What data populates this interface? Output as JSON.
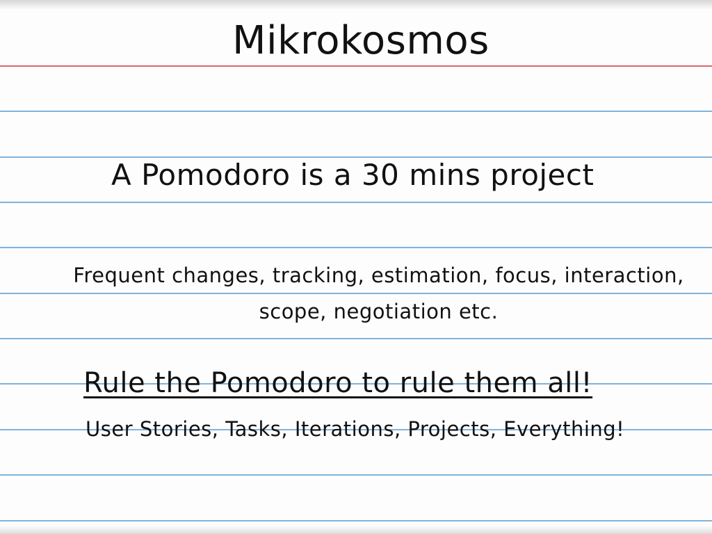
{
  "slide": {
    "title": "Mikrokosmos",
    "heading": "A Pomodoro is a 30 mins project",
    "paragraph": "Frequent changes, tracking, estimation, focus, interaction, scope, negotiation etc.",
    "rule_line": "Rule the Pomodoro to rule them all!",
    "rule_sub": "User Stories, Tasks, Iterations, Projects, Everything!"
  },
  "colors": {
    "margin_line": "#e0666c",
    "ruled_line": "#7fb3dc",
    "ink": "#111111",
    "paper": "#fdfdfd"
  }
}
